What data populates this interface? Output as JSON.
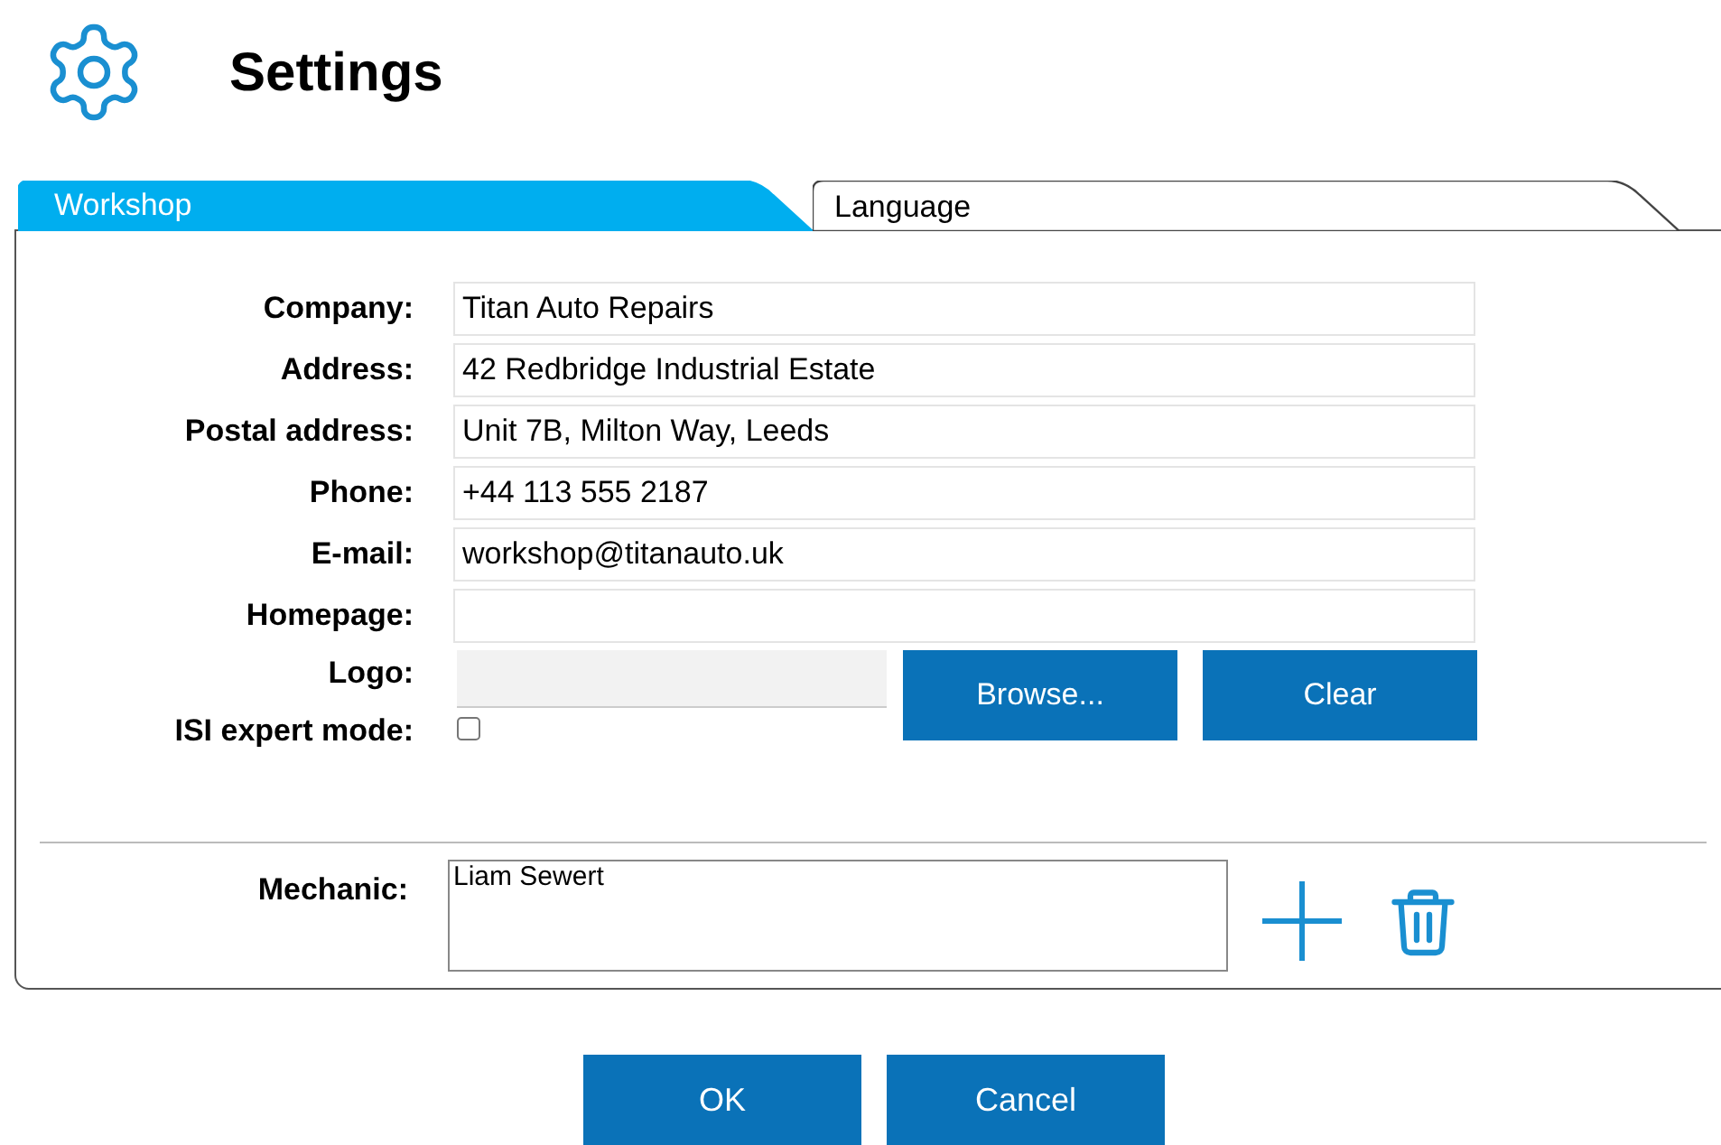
{
  "title": "Settings",
  "tabs": [
    {
      "label": "Workshop",
      "selected": true
    },
    {
      "label": "Language",
      "selected": false
    }
  ],
  "fields": [
    {
      "label": "Company:",
      "value": "Titan Auto Repairs"
    },
    {
      "label": "Address:",
      "value": "42 Redbridge Industrial Estate"
    },
    {
      "label": "Postal address:",
      "value": "Unit 7B, Milton Way, Leeds"
    },
    {
      "label": "Phone:",
      "value": "+44 113 555 2187"
    },
    {
      "label": "E-mail:",
      "value": "workshop@titanauto.uk"
    },
    {
      "label": "Homepage:"
    }
  ],
  "logo": {
    "label": "Logo:",
    "buttons": [
      "Browse...",
      "Clear"
    ]
  },
  "expert_mode": {
    "label": "ISI expert mode:",
    "checked": false
  },
  "mechanic": {
    "label": "Mechanic:",
    "items": [
      "Liam Sewert"
    ]
  },
  "buttons": [
    "OK",
    "Cancel"
  ]
}
